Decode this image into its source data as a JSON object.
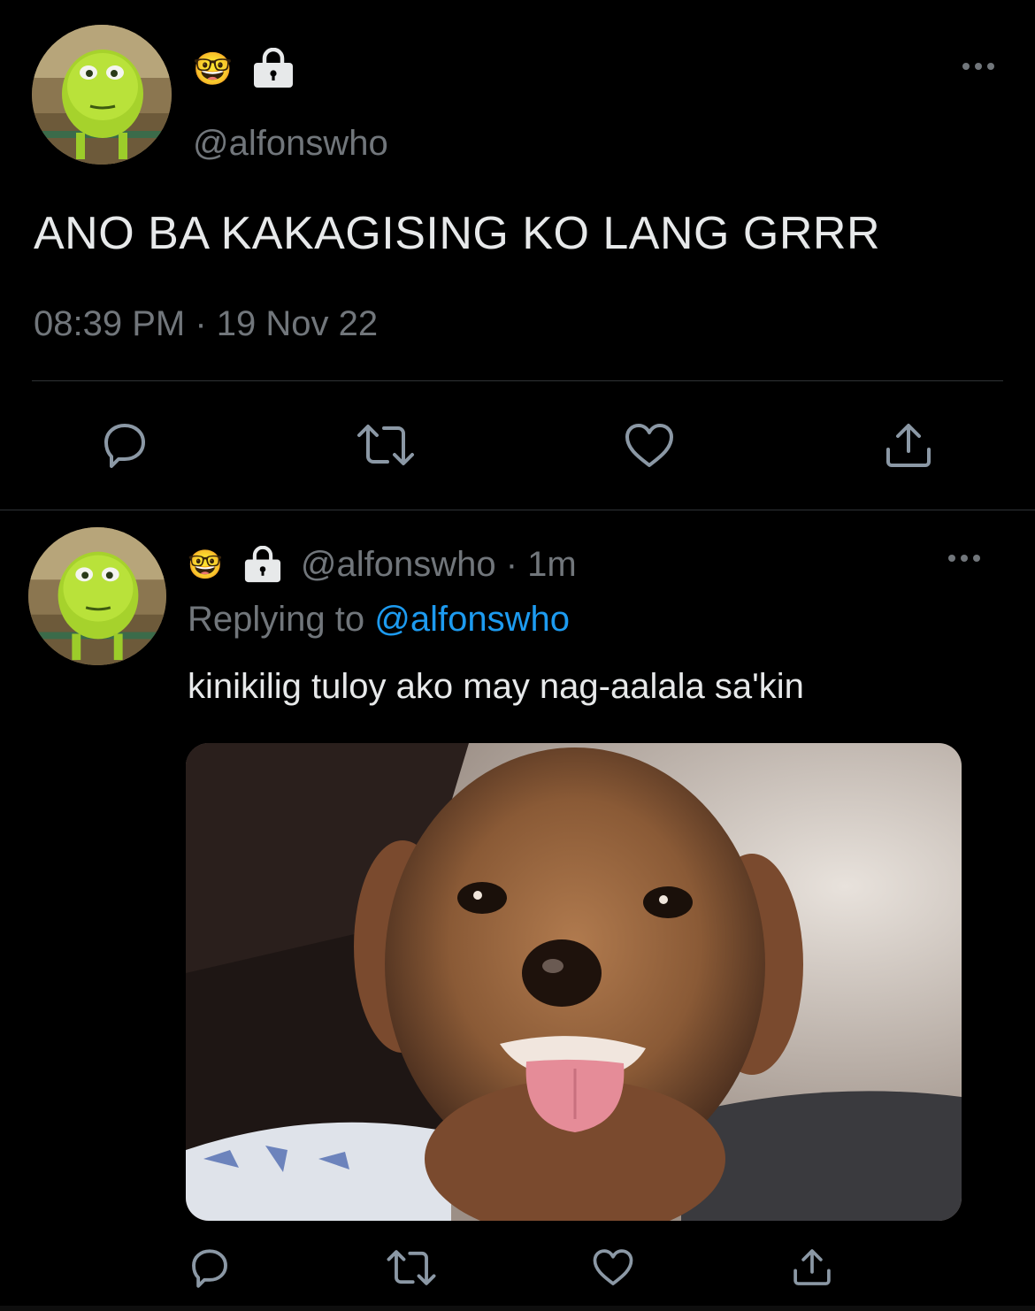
{
  "colors": {
    "background": "#000000",
    "text_primary": "#e7e9ea",
    "text_secondary": "#71767b",
    "link": "#1d9bf0",
    "divider": "#2f3336"
  },
  "main_tweet": {
    "badge_emoji": "🤓",
    "lock_icon": "lock-icon",
    "handle": "@alfonswho",
    "text": "ANO BA KAKAGISING KO LANG GRRR",
    "timestamp": "08:39 PM · 19 Nov 22",
    "actions": [
      "reply-icon",
      "retweet-icon",
      "like-icon",
      "share-icon"
    ],
    "more_icon": "more-icon"
  },
  "reply_tweet": {
    "badge_emoji": "🤓",
    "lock_icon": "lock-icon",
    "handle": "@alfonswho",
    "separator": " · ",
    "time_ago": "1m",
    "replying_prefix": "Replying to ",
    "replying_to": "@alfonswho",
    "text": "kinikilig tuloy ako may nag-aalala sa'kin",
    "media_icon": "dog-photo",
    "actions": [
      "reply-icon",
      "retweet-icon",
      "like-icon",
      "share-icon"
    ],
    "more_icon": "more-icon"
  }
}
